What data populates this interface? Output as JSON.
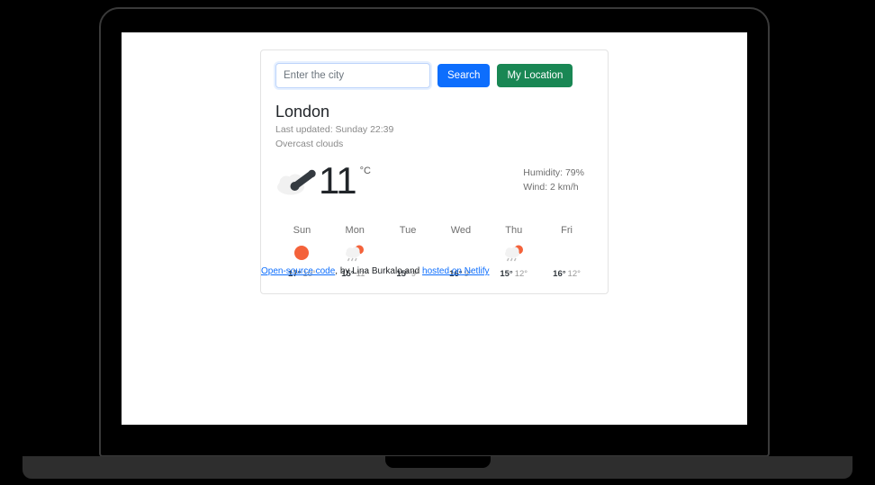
{
  "search": {
    "placeholder": "Enter the city",
    "value": "",
    "search_label": "Search",
    "location_label": "My Location"
  },
  "current": {
    "city": "London",
    "last_updated": "Last updated: Sunday 22:39",
    "description": "Overcast clouds",
    "temperature": "11",
    "unit": "°C",
    "humidity": "Humidity: 79%",
    "wind": "Wind: 2 km/h",
    "icon": "overcast-clouds-icon"
  },
  "forecast": [
    {
      "day": "Sun",
      "icon": "clear-sun-icon",
      "max": "17°",
      "min": "10°"
    },
    {
      "day": "Mon",
      "icon": "sun-rain-icon",
      "max": "15°",
      "min": "11°"
    },
    {
      "day": "Tue",
      "icon": "missing-icon",
      "max": "15°",
      "min": "9°"
    },
    {
      "day": "Wed",
      "icon": "missing-icon",
      "max": "16°",
      "min": "9°"
    },
    {
      "day": "Thu",
      "icon": "sun-rain-icon",
      "max": "15°",
      "min": "12°"
    },
    {
      "day": "Fri",
      "icon": "missing-icon",
      "max": "16°",
      "min": "12°"
    }
  ],
  "footer": {
    "link_code": "Open-source code",
    "middle": ", by Lina Burkalo and ",
    "link_host": "hosted on Netlify"
  },
  "colors": {
    "search_button": "#0d6efd",
    "location_button": "#198754",
    "link": "#0d6efd",
    "sun": "#f4623a",
    "card_border": "#e3e3e3"
  }
}
